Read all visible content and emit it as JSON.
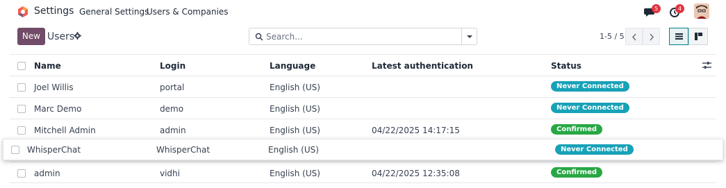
{
  "navbar": {
    "app_name": "Settings",
    "menu": [
      "General Settings",
      "Users & Companies"
    ],
    "messages_badge": "5",
    "activities_badge": "4"
  },
  "control_panel": {
    "new_label": "New",
    "breadcrumb": "Users",
    "search_placeholder": "Search...",
    "pager": "1-5 / 5"
  },
  "table": {
    "columns": [
      "Name",
      "Login",
      "Language",
      "Latest authentication",
      "Status"
    ],
    "rows": [
      {
        "name": "Joel Willis",
        "login": "portal",
        "language": "English (US)",
        "latest_auth": "",
        "status": "Never Connected",
        "status_color": "#17a2b8"
      },
      {
        "name": "Marc Demo",
        "login": "demo",
        "language": "English (US)",
        "latest_auth": "",
        "status": "Never Connected",
        "status_color": "#17a2b8"
      },
      {
        "name": "Mitchell Admin",
        "login": "admin",
        "language": "English (US)",
        "latest_auth": "04/22/2025 14:17:15",
        "status": "Confirmed",
        "status_color": "#28a745"
      },
      {
        "name": "admin",
        "login": "vidhi",
        "language": "English (US)",
        "latest_auth": "04/22/2025 12:35:08",
        "status": "Confirmed",
        "status_color": "#28a745"
      }
    ],
    "dragged_row": {
      "name": "WhisperChat",
      "login": "WhisperChat",
      "language": "English (US)",
      "latest_auth": "",
      "status": "Never Connected",
      "status_color": "#17a2b8"
    }
  },
  "colors": {
    "primary": "#714b67",
    "never_connected": "#17a2b8",
    "confirmed": "#28a745",
    "badge": "#e3343f",
    "active_view": "#017e84"
  }
}
